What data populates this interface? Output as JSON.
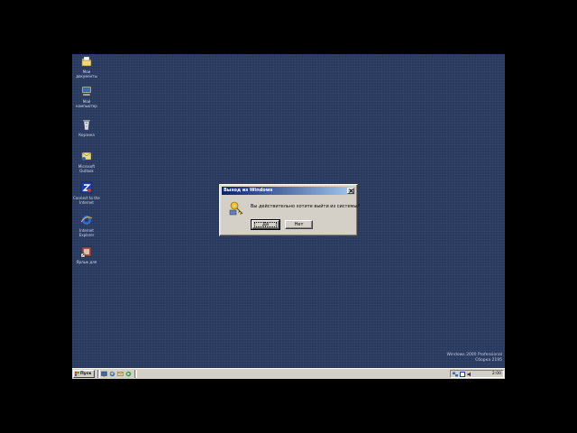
{
  "desktop": {
    "icons": [
      {
        "label_line1": "Мои",
        "label_line2": "документы",
        "icon": "my-documents-icon"
      },
      {
        "label_line1": "Мой",
        "label_line2": "компьютер",
        "icon": "my-computer-icon"
      },
      {
        "label_line1": "Корзина",
        "label_line2": "",
        "icon": "recycle-bin-icon"
      },
      {
        "label_line1": "Microsoft",
        "label_line2": "Outlook",
        "icon": "outlook-icon"
      },
      {
        "label_line1": "Connect to the",
        "label_line2": "Internet",
        "icon": "internet-connect-icon"
      },
      {
        "label_line1": "Internet",
        "label_line2": "Explorer",
        "icon": "internet-explorer-icon"
      },
      {
        "label_line1": "Ярлык для",
        "label_line2": "",
        "icon": "shortcut-icon"
      }
    ],
    "watermark_line1": "Windows 2000 Professional",
    "watermark_line2": "Сборка 2195"
  },
  "dialog": {
    "title": "Выход из Windows",
    "message": "Вы действительно хотите выйти из системы?",
    "yes_label": "Да",
    "no_label": "Нет",
    "icon": "logoff-key-icon"
  },
  "taskbar": {
    "start_label": "Пуск",
    "clock": "2:00",
    "quick_launch": [
      "show-desktop-icon",
      "internet-explorer-icon",
      "outlook-express-icon"
    ],
    "tray_icons": [
      "network-icon",
      "language-indicator-icon"
    ]
  },
  "colors": {
    "desktop_bg": "#2b3d63",
    "titlebar_start": "#0a246a",
    "titlebar_end": "#a6caf0",
    "face": "#d4d0c8"
  }
}
